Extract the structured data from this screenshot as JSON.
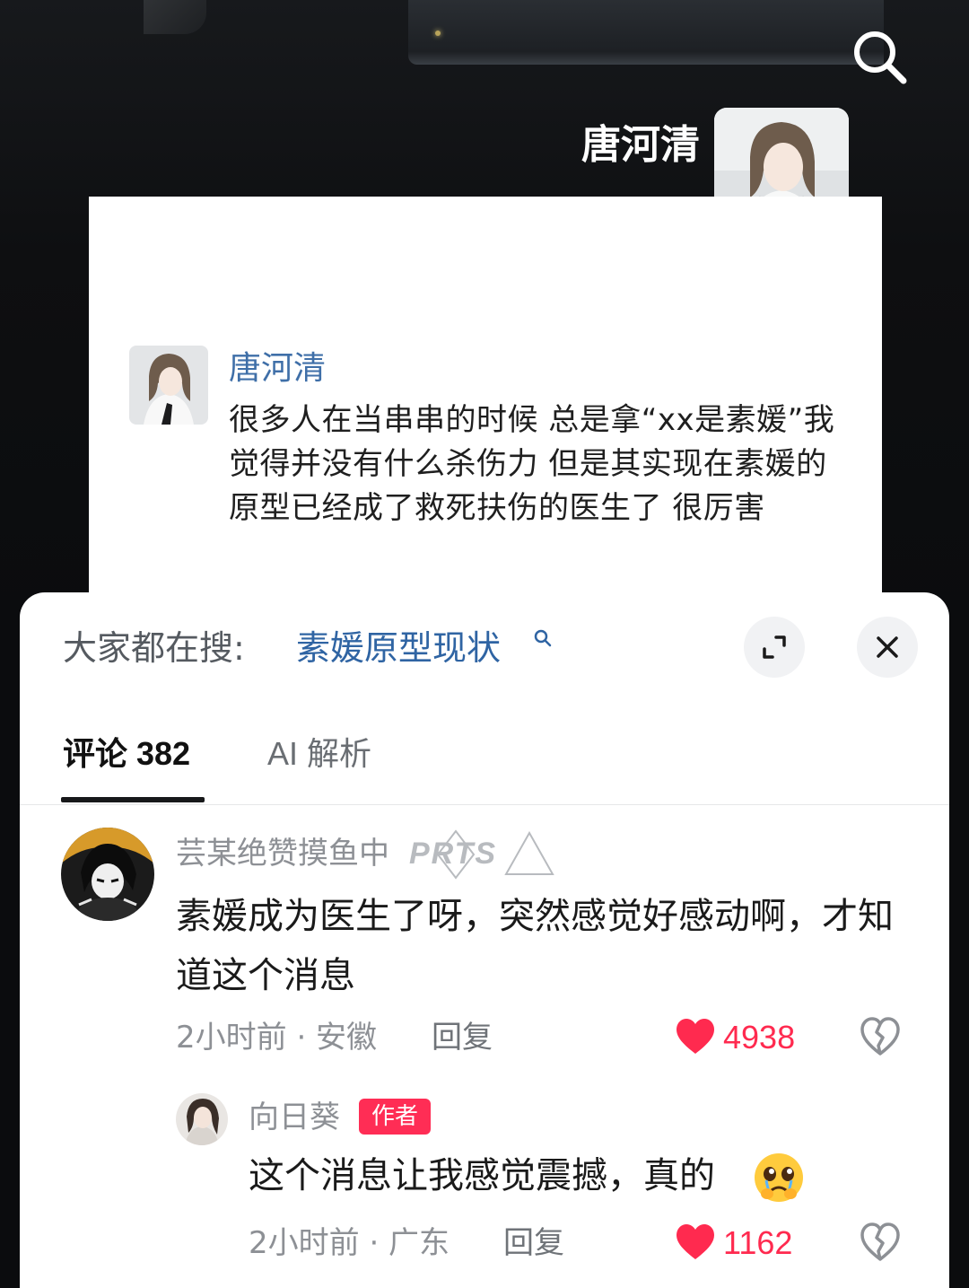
{
  "header": {
    "author_name": "唐河清"
  },
  "post": {
    "author_name": "唐河清",
    "text": "很多人在当串串的时候 总是拿“xx是素媛”我觉得并没有什么杀伤力 但是其实现在素媛的原型已经成了救死扶伤的医生了 很厉害"
  },
  "sheet": {
    "search_label": "大家都在搜:",
    "search_term": "素媛原型现状",
    "tabs": [
      {
        "label": "评论 382",
        "active": true
      },
      {
        "label": "AI 解析",
        "active": false
      }
    ]
  },
  "comments": [
    {
      "user": "芸某绝赞摸鱼中",
      "badge": "PRTS",
      "text": "素媛成为医生了呀，突然感觉好感动啊，才知道这个消息",
      "meta": "2小时前 · 安徽",
      "reply_label": "回复",
      "likes": "4938"
    },
    {
      "user": "向日葵",
      "author_badge": "作者",
      "text": "这个消息让我感觉震撼，真的",
      "emoji": "pleading-face",
      "meta": "2小时前 · 广东",
      "reply_label": "回复",
      "likes": "1162"
    }
  ],
  "colors": {
    "link_blue": "#2f64a3",
    "author_blue": "#3f6fa8",
    "like_red": "#ff2a4f",
    "badge_red": "#ff2d55"
  },
  "icons": [
    "search-icon",
    "expand-icon",
    "close-icon",
    "heart-icon",
    "broken-heart-icon",
    "pleading-face-emoji"
  ]
}
